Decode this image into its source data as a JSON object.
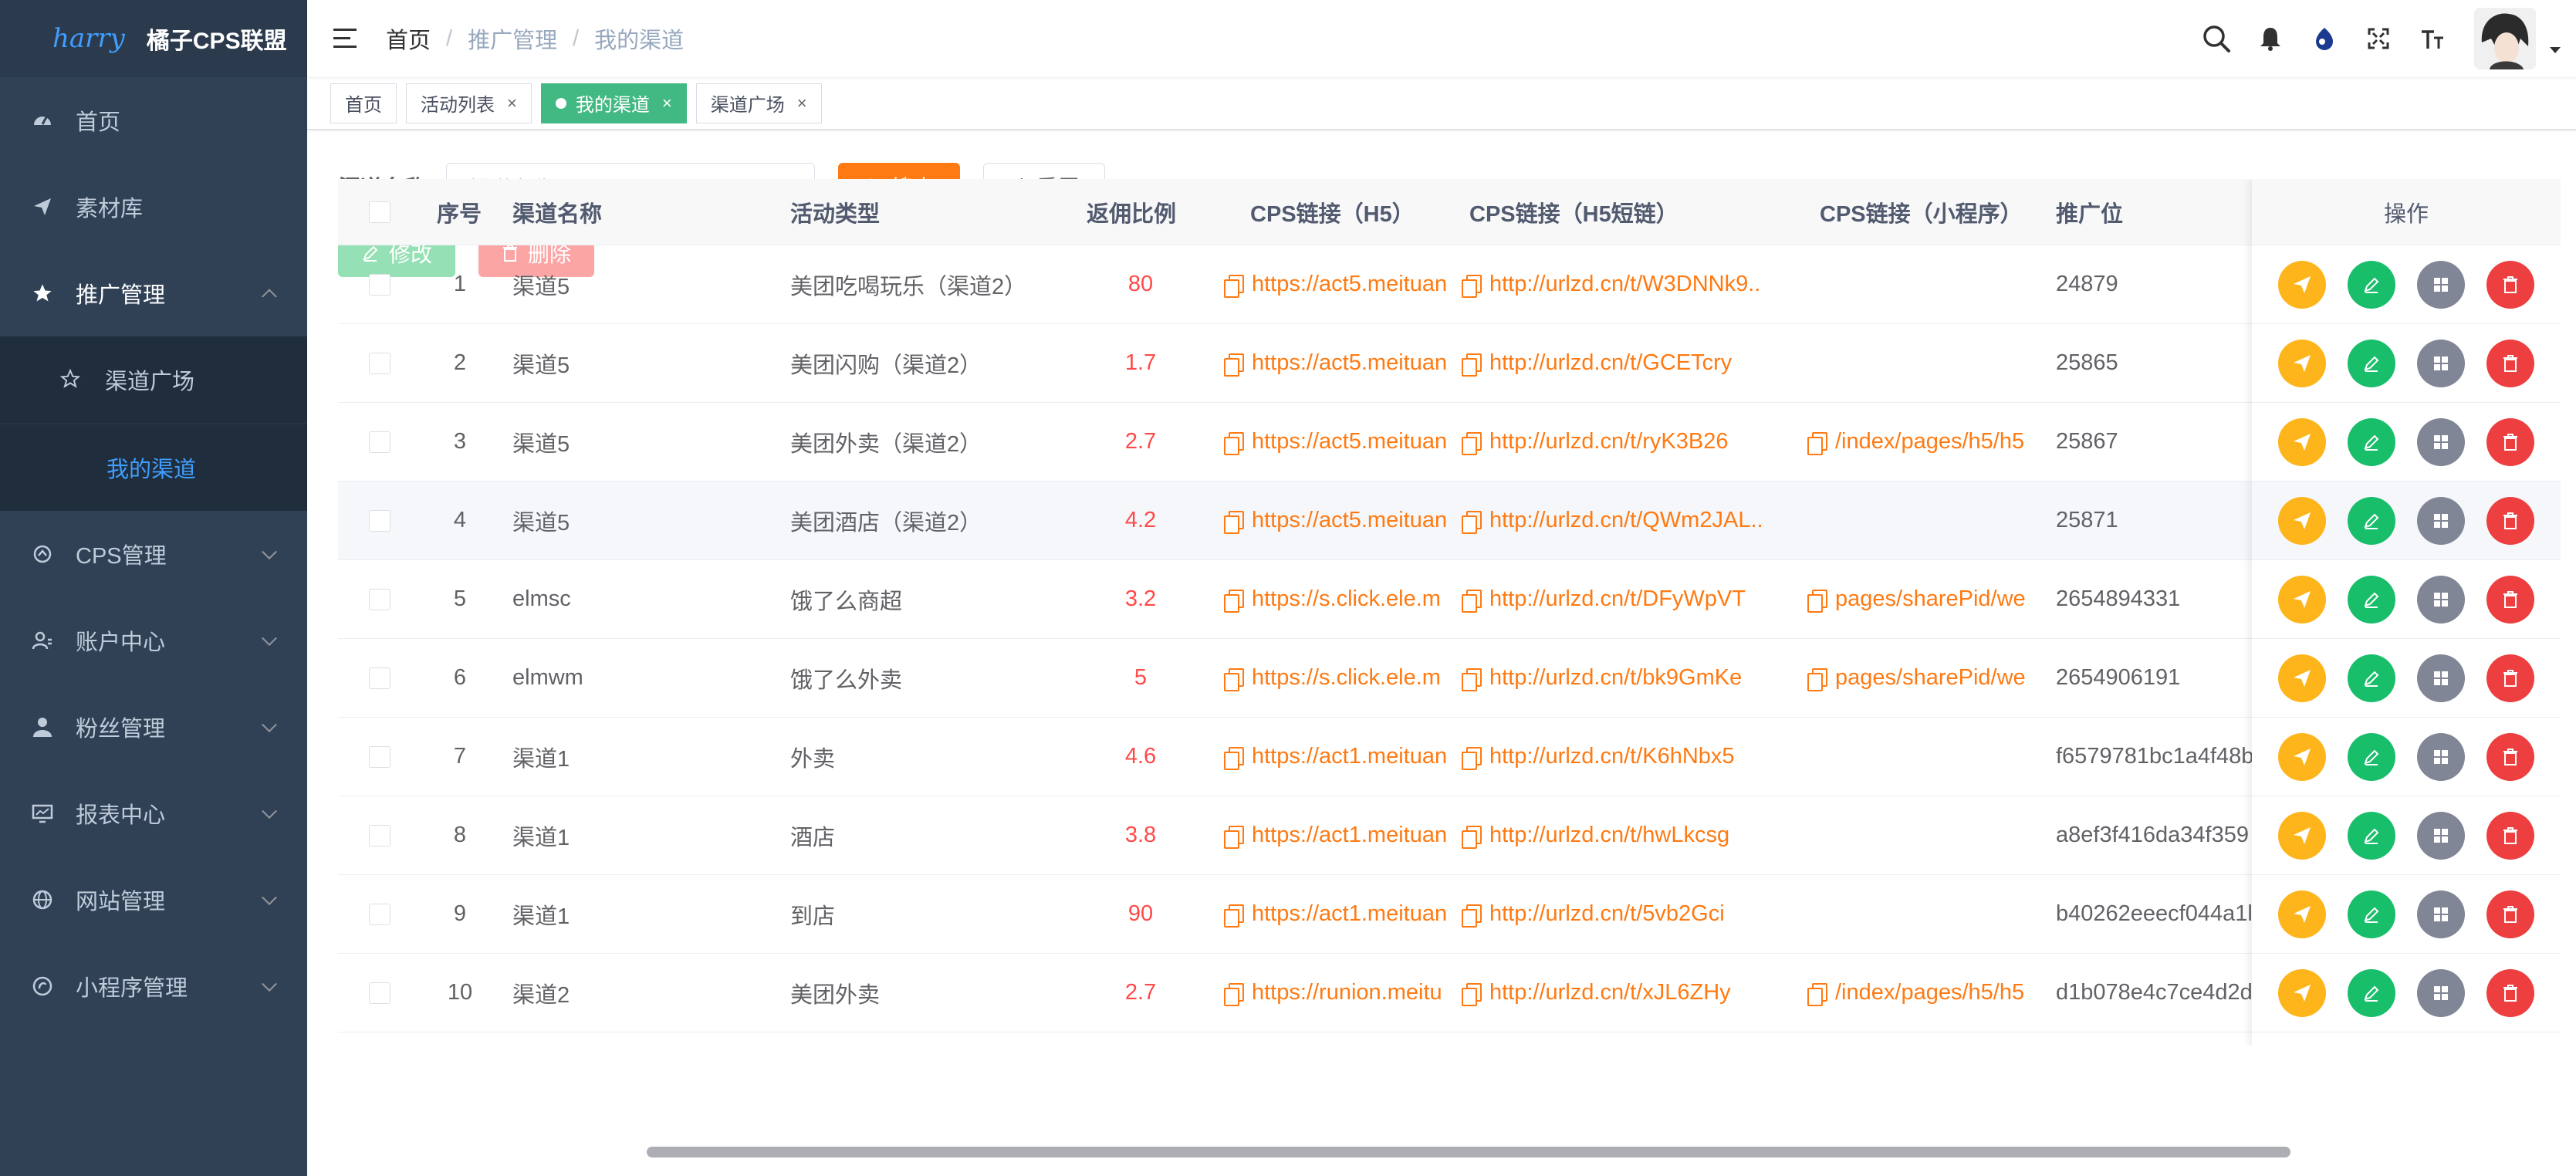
{
  "sidebar": {
    "logo_text": "harry",
    "title": "橘子CPS联盟",
    "items": [
      {
        "label": "首页",
        "icon": "dashboard-icon"
      },
      {
        "label": "素材库",
        "icon": "paper-plane-icon"
      },
      {
        "label": "推广管理",
        "icon": "star-icon"
      },
      {
        "label": "渠道广场",
        "icon": "star-outline-icon"
      },
      {
        "label": "我的渠道",
        "icon": ""
      },
      {
        "label": "CPS管理",
        "icon": "cps-icon"
      },
      {
        "label": "账户中心",
        "icon": "account-icon"
      },
      {
        "label": "粉丝管理",
        "icon": "user-icon"
      },
      {
        "label": "报表中心",
        "icon": "report-icon"
      },
      {
        "label": "网站管理",
        "icon": "globe-icon"
      },
      {
        "label": "小程序管理",
        "icon": "miniprogram-icon"
      }
    ]
  },
  "breadcrumb": {
    "home": "首页",
    "parent": "推广管理",
    "current": "我的渠道"
  },
  "tags": [
    {
      "label": "首页"
    },
    {
      "label": "活动列表"
    },
    {
      "label": "我的渠道"
    },
    {
      "label": "渠道广场"
    }
  ],
  "search": {
    "label": "渠道名称",
    "placeholder": "渠道名称",
    "search_btn": "搜索",
    "reset_btn": "重置"
  },
  "toolbar": {
    "edit": "修改",
    "delete": "删除"
  },
  "table": {
    "headers": {
      "index": "序号",
      "name": "渠道名称",
      "type": "活动类型",
      "rate": "返佣比例",
      "h5": "CPS链接（H5）",
      "short": "CPS链接（H5短链）",
      "mini": "CPS链接（小程序）",
      "pos": "推广位",
      "ops": "操作"
    },
    "rows": [
      {
        "index": "1",
        "name": "渠道5",
        "type": "美团吃喝玩乐（渠道2）",
        "rate": "80",
        "h5": "https://act5.meituan",
        "short": "http://urlzd.cn/t/W3DNNk9...",
        "mini": "",
        "pos": "24879"
      },
      {
        "index": "2",
        "name": "渠道5",
        "type": "美团闪购（渠道2）",
        "rate": "1.7",
        "h5": "https://act5.meituan",
        "short": "http://urlzd.cn/t/GCETcry",
        "mini": "",
        "pos": "25865"
      },
      {
        "index": "3",
        "name": "渠道5",
        "type": "美团外卖（渠道2）",
        "rate": "2.7",
        "h5": "https://act5.meituan",
        "short": "http://urlzd.cn/t/ryK3B26",
        "mini": "/index/pages/h5/h5",
        "pos": "25867"
      },
      {
        "index": "4",
        "name": "渠道5",
        "type": "美团酒店（渠道2）",
        "rate": "4.2",
        "h5": "https://act5.meituan",
        "short": "http://urlzd.cn/t/QWm2JAL...",
        "mini": "",
        "pos": "25871"
      },
      {
        "index": "5",
        "name": "elmsc",
        "type": "饿了么商超",
        "rate": "3.2",
        "h5": "https://s.click.ele.m",
        "short": "http://urlzd.cn/t/DFyWpVT",
        "mini": "pages/sharePid/we",
        "pos": "2654894331"
      },
      {
        "index": "6",
        "name": "elmwm",
        "type": "饿了么外卖",
        "rate": "5",
        "h5": "https://s.click.ele.m",
        "short": "http://urlzd.cn/t/bk9GmKe",
        "mini": "pages/sharePid/we",
        "pos": "2654906191"
      },
      {
        "index": "7",
        "name": "渠道1",
        "type": "外卖",
        "rate": "4.6",
        "h5": "https://act1.meituan",
        "short": "http://urlzd.cn/t/K6hNbx5",
        "mini": "",
        "pos": "f6579781bc1a4f48b"
      },
      {
        "index": "8",
        "name": "渠道1",
        "type": "酒店",
        "rate": "3.8",
        "h5": "https://act1.meituan",
        "short": "http://urlzd.cn/t/hwLkcsg",
        "mini": "",
        "pos": "a8ef3f416da34f359"
      },
      {
        "index": "9",
        "name": "渠道1",
        "type": "到店",
        "rate": "90",
        "h5": "https://act1.meituan",
        "short": "http://urlzd.cn/t/5vb2Gci",
        "mini": "",
        "pos": "b40262eeecf044a1l"
      },
      {
        "index": "10",
        "name": "渠道2",
        "type": "美团外卖",
        "rate": "2.7",
        "h5": "https://runion.meitu",
        "short": "http://urlzd.cn/t/xJL6ZHy",
        "mini": "/index/pages/h5/h5",
        "pos": "d1b078e4c7ce4d2d"
      }
    ]
  },
  "colors": {
    "accent": "#ff7a12",
    "sidebar_bg": "#304156",
    "active_tag": "#42b983",
    "rate": "#ff4949"
  }
}
